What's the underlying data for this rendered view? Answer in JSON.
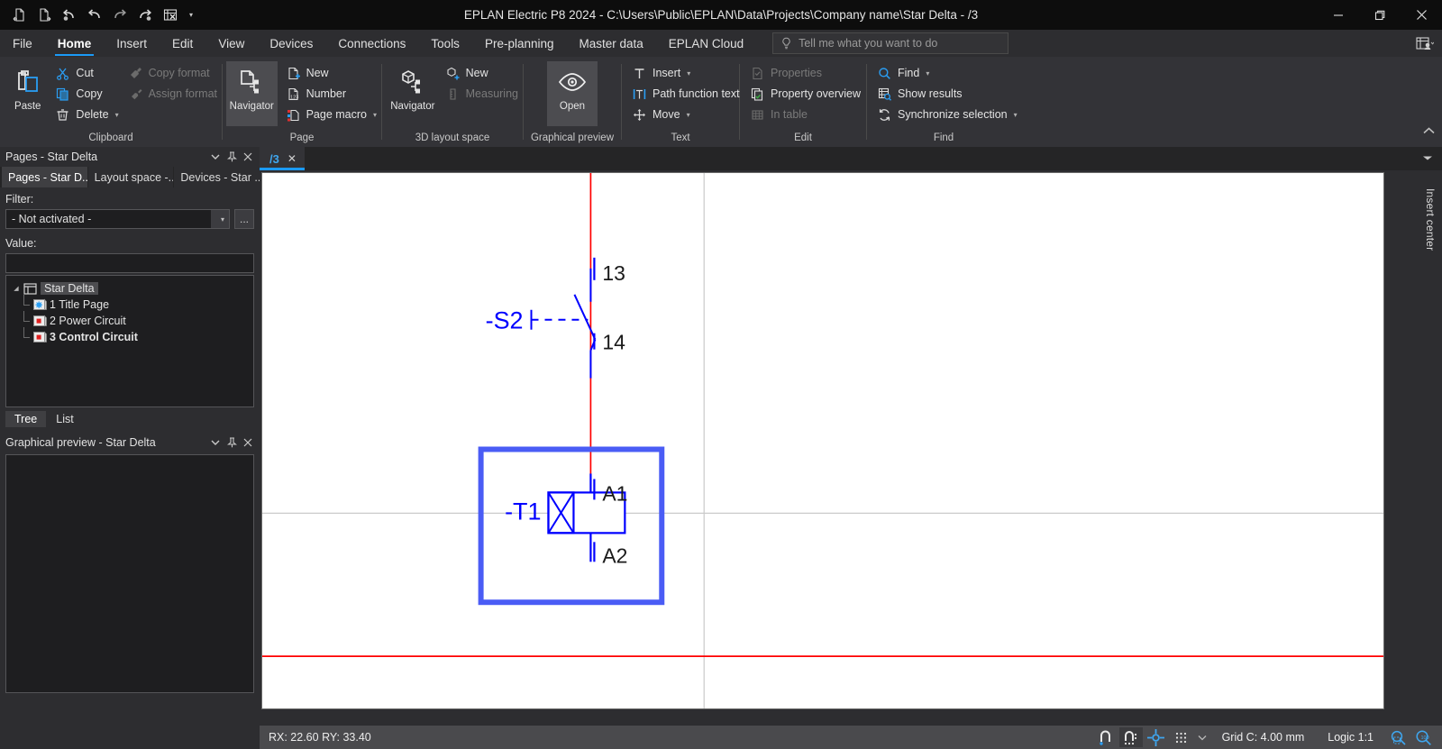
{
  "window": {
    "title": "EPLAN Electric P8 2024 - C:\\Users\\Public\\EPLAN\\Data\\Projects\\Company name\\Star Delta - /3",
    "minimize_label": "—",
    "maximize_label": "❐",
    "close_label": "✕"
  },
  "quick_access": [
    {
      "name": "open-page-previous-icon",
      "label": ""
    },
    {
      "name": "open-page-next-icon",
      "label": ""
    },
    {
      "name": "undo-dropdown-icon",
      "label": ""
    },
    {
      "name": "undo-icon",
      "label": ""
    },
    {
      "name": "redo-icon",
      "label": ""
    },
    {
      "name": "redo-dropdown-icon",
      "label": ""
    },
    {
      "name": "close-project-icon",
      "label": ""
    }
  ],
  "menu": {
    "tabs": [
      {
        "label": "File",
        "active": false
      },
      {
        "label": "Home",
        "active": true
      },
      {
        "label": "Insert",
        "active": false
      },
      {
        "label": "Edit",
        "active": false
      },
      {
        "label": "View",
        "active": false
      },
      {
        "label": "Devices",
        "active": false
      },
      {
        "label": "Connections",
        "active": false
      },
      {
        "label": "Tools",
        "active": false
      },
      {
        "label": "Pre-planning",
        "active": false
      },
      {
        "label": "Master data",
        "active": false
      },
      {
        "label": "EPLAN Cloud",
        "active": false
      }
    ],
    "tellme_placeholder": "Tell me what you want to do"
  },
  "ribbon": {
    "groups": [
      {
        "label": "Clipboard",
        "big": {
          "label": "Paste",
          "icon": "paste-icon"
        },
        "columns": [
          [
            {
              "label": "Cut",
              "icon": "cut-icon",
              "disabled": false,
              "chevron": false
            },
            {
              "label": "Copy",
              "icon": "copy-icon",
              "disabled": false,
              "chevron": false
            },
            {
              "label": "Delete",
              "icon": "delete-icon",
              "disabled": false,
              "chevron": true
            }
          ],
          [
            {
              "label": "Copy format",
              "icon": "copy-format-icon",
              "disabled": true,
              "chevron": false
            },
            {
              "label": "Assign format",
              "icon": "assign-format-icon",
              "disabled": true,
              "chevron": false
            }
          ]
        ]
      },
      {
        "label": "Page",
        "big": {
          "label": "Navigator",
          "icon": "page-navigator-icon",
          "selected": true
        },
        "columns": [
          [
            {
              "label": "New",
              "icon": "new-page-icon",
              "disabled": false,
              "chevron": false
            },
            {
              "label": "Number",
              "icon": "number-pages-icon",
              "disabled": false,
              "chevron": false
            },
            {
              "label": "Page macro",
              "icon": "page-macro-icon",
              "disabled": false,
              "chevron": true
            }
          ]
        ]
      },
      {
        "label": "3D layout space",
        "big": {
          "label": "Navigator",
          "icon": "layout-space-navigator-icon"
        },
        "columns": [
          [
            {
              "label": "New",
              "icon": "new-layout-icon",
              "disabled": false,
              "chevron": false
            },
            {
              "label": "Measuring",
              "icon": "measuring-icon",
              "disabled": true,
              "chevron": false
            }
          ]
        ]
      },
      {
        "label": "Graphical preview",
        "big": {
          "label": "Open",
          "icon": "eye-icon",
          "selected": true
        },
        "columns": []
      },
      {
        "label": "Text",
        "big": null,
        "columns": [
          [
            {
              "label": "Insert",
              "icon": "text-insert-icon",
              "disabled": false,
              "chevron": true
            },
            {
              "label": "Path function text",
              "icon": "path-function-text-icon",
              "disabled": false,
              "chevron": false
            },
            {
              "label": "Move",
              "icon": "move-icon",
              "disabled": false,
              "chevron": true
            }
          ]
        ]
      },
      {
        "label": "Edit",
        "big": null,
        "columns": [
          [
            {
              "label": "Properties",
              "icon": "properties-icon",
              "disabled": true,
              "chevron": false
            },
            {
              "label": "Property overview",
              "icon": "property-overview-icon",
              "disabled": false,
              "chevron": false
            },
            {
              "label": "In table",
              "icon": "in-table-icon",
              "disabled": true,
              "chevron": false
            }
          ]
        ]
      },
      {
        "label": "Find",
        "big": null,
        "columns": [
          [
            {
              "label": "Find",
              "icon": "find-icon",
              "disabled": false,
              "chevron": true
            },
            {
              "label": "Show results",
              "icon": "show-results-icon",
              "disabled": false,
              "chevron": false
            },
            {
              "label": "Synchronize selection",
              "icon": "synchronize-selection-icon",
              "disabled": false,
              "chevron": true
            }
          ]
        ]
      }
    ]
  },
  "pages_panel": {
    "header_title": "Pages - Star Delta",
    "tabs": [
      {
        "label": "Pages - Star D...",
        "active": true
      },
      {
        "label": "Layout space -...",
        "active": false
      },
      {
        "label": "Devices - Star ...",
        "active": false
      }
    ],
    "filter_label": "Filter:",
    "filter_value": "- Not activated -",
    "filter_more_label": "...",
    "value_label": "Value:",
    "value_text": "",
    "tree": {
      "root": {
        "label": "Star Delta",
        "selected": true,
        "icon": "project-icon"
      },
      "children": [
        {
          "label": "1 Title Page",
          "bold": false,
          "icon": "title-page-icon"
        },
        {
          "label": "2 Power Circuit",
          "bold": false,
          "icon": "schematic-page-icon"
        },
        {
          "label": "3 Control Circuit",
          "bold": true,
          "icon": "schematic-page-icon"
        }
      ]
    },
    "view_tabs": [
      {
        "label": "Tree",
        "active": true
      },
      {
        "label": "List",
        "active": false
      }
    ]
  },
  "preview_panel": {
    "header_title": "Graphical preview - Star Delta"
  },
  "document": {
    "tab_label": "/3",
    "tab_close": "✕"
  },
  "right_dock": {
    "vertical_tab": "Insert center"
  },
  "status_bar": {
    "coordinates": "RX: 22.60 RY: 33.40",
    "grid": "Grid C: 4.00 mm",
    "logic": "Logic 1:1",
    "icons": [
      {
        "name": "snap-object-icon",
        "selected": false
      },
      {
        "name": "snap-grid-icon",
        "selected": true
      },
      {
        "name": "crosshair-icon",
        "selected": false
      },
      {
        "name": "grid-display-icon",
        "selected": false
      },
      {
        "name": "zoom-window-icon",
        "selected": false
      },
      {
        "name": "zoom-full-icon",
        "selected": false
      }
    ]
  },
  "schematic": {
    "colors": {
      "wire": "#ff0000",
      "symbol": "#0000ff",
      "selection": "#4a5cf5",
      "terminal_text": "#202020",
      "frame_line": "#c8c8c8"
    },
    "devices": [
      {
        "name": "-S2",
        "type": "normally-open-contact",
        "label": "-S2",
        "terminals": [
          {
            "label": "13",
            "position": "top"
          },
          {
            "label": "14",
            "position": "bottom"
          }
        ]
      },
      {
        "name": "-T1",
        "type": "timer-relay-coil",
        "label": "-T1",
        "selected": true,
        "terminals": [
          {
            "label": "A1",
            "position": "top"
          },
          {
            "label": "A2",
            "position": "bottom"
          }
        ]
      }
    ]
  }
}
